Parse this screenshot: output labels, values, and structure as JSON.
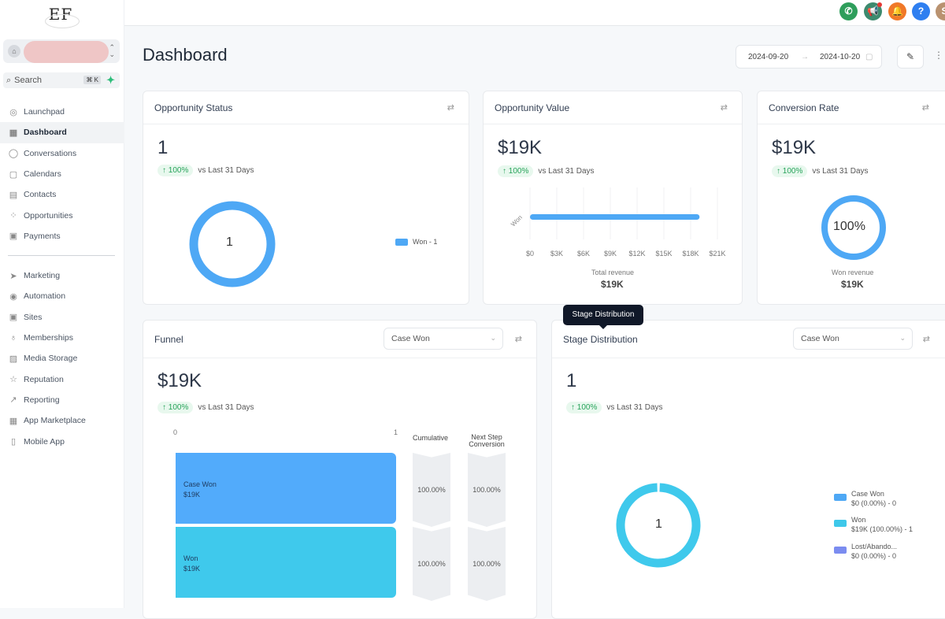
{
  "app": {
    "logo_text": "EF",
    "account_name": "",
    "search_placeholder": "Search",
    "search_shortcut": "⌘ K"
  },
  "sidebar": {
    "items": [
      {
        "label": "Launchpad",
        "icon": "rocket-icon"
      },
      {
        "label": "Dashboard",
        "icon": "grid-icon",
        "active": true
      },
      {
        "label": "Conversations",
        "icon": "chat-icon"
      },
      {
        "label": "Calendars",
        "icon": "calendar-icon"
      },
      {
        "label": "Contacts",
        "icon": "contacts-icon"
      },
      {
        "label": "Opportunities",
        "icon": "pipeline-icon"
      },
      {
        "label": "Payments",
        "icon": "payment-icon"
      }
    ],
    "items2": [
      {
        "label": "Marketing",
        "icon": "send-icon"
      },
      {
        "label": "Automation",
        "icon": "automation-icon"
      },
      {
        "label": "Sites",
        "icon": "sites-icon"
      },
      {
        "label": "Memberships",
        "icon": "award-icon"
      },
      {
        "label": "Media Storage",
        "icon": "image-icon"
      },
      {
        "label": "Reputation",
        "icon": "star-icon"
      },
      {
        "label": "Reporting",
        "icon": "trend-icon"
      },
      {
        "label": "App Marketplace",
        "icon": "apps-icon"
      },
      {
        "label": "Mobile App",
        "icon": "phone-icon"
      }
    ]
  },
  "topbar": {
    "avatar_initial": "S",
    "help": "?"
  },
  "header": {
    "title": "Dashboard",
    "date_from": "2024-09-20",
    "date_to": "2024-10-20",
    "arrow": "→"
  },
  "cards": {
    "opp_status": {
      "title": "Opportunity Status",
      "value": "1",
      "delta": "↑ 100%",
      "compare": "vs Last 31 Days",
      "center": "1",
      "legend": "Won - 1"
    },
    "opp_value": {
      "title": "Opportunity Value",
      "value": "$19K",
      "delta": "↑ 100%",
      "compare": "vs Last 31 Days",
      "bar_label": "Won",
      "ticks": [
        "$0",
        "$3K",
        "$6K",
        "$9K",
        "$12K",
        "$15K",
        "$18K",
        "$21K"
      ],
      "total_label": "Total revenue",
      "total": "$19K"
    },
    "conversion": {
      "title": "Conversion Rate",
      "value": "$19K",
      "delta": "↑ 100%",
      "compare": "vs Last 31 Days",
      "center": "100%",
      "sub_label": "Won revenue",
      "sub_value": "$19K"
    },
    "funnel": {
      "title": "Funnel",
      "select": "Case Won",
      "value": "$19K",
      "delta": "↑ 100%",
      "compare": "vs Last 31 Days",
      "axis_min": "0",
      "axis_max": "1",
      "col1": "Cumulative",
      "col2": "Next Step Conversion",
      "stages": [
        {
          "name": "Case Won",
          "value": "$19K",
          "cumulative": "100.00%",
          "next": "100.00%"
        },
        {
          "name": "Won",
          "value": "$19K",
          "cumulative": "100.00%",
          "next": "100.00%"
        }
      ]
    },
    "stage": {
      "title": "Stage Distribution",
      "tooltip": "Stage Distribution",
      "select": "Case Won",
      "value": "1",
      "delta": "↑ 100%",
      "compare": "vs Last 31 Days",
      "center": "1",
      "legend": [
        {
          "name": "Case Won",
          "detail": "$0 (0.00%) - 0",
          "color": "#4ea8f5"
        },
        {
          "name": "Won",
          "detail": "$19K (100.00%) - 1",
          "color": "#3ec8ea"
        },
        {
          "name": "Lost/Abando...",
          "detail": "$0 (0.00%) - 0",
          "color": "#7b8cf0"
        }
      ]
    }
  },
  "chart_data": [
    {
      "type": "pie",
      "title": "Opportunity Status",
      "categories": [
        "Won"
      ],
      "values": [
        1
      ],
      "colors": [
        "#4ea8f5"
      ]
    },
    {
      "type": "bar",
      "title": "Opportunity Value",
      "categories": [
        "Won"
      ],
      "values": [
        19000
      ],
      "xlabel": "Total revenue",
      "xlim": [
        0,
        21000
      ],
      "ticks": [
        "$0",
        "$3K",
        "$6K",
        "$9K",
        "$12K",
        "$15K",
        "$18K",
        "$21K"
      ]
    },
    {
      "type": "pie",
      "title": "Conversion Rate",
      "categories": [
        "Won"
      ],
      "values": [
        100
      ]
    },
    {
      "type": "bar",
      "title": "Funnel",
      "categories": [
        "Case Won",
        "Won"
      ],
      "values": [
        1,
        1
      ],
      "xlim": [
        0,
        1
      ]
    },
    {
      "type": "pie",
      "title": "Stage Distribution",
      "categories": [
        "Case Won",
        "Won",
        "Lost/Abandoned"
      ],
      "values": [
        0,
        1,
        0
      ]
    }
  ]
}
